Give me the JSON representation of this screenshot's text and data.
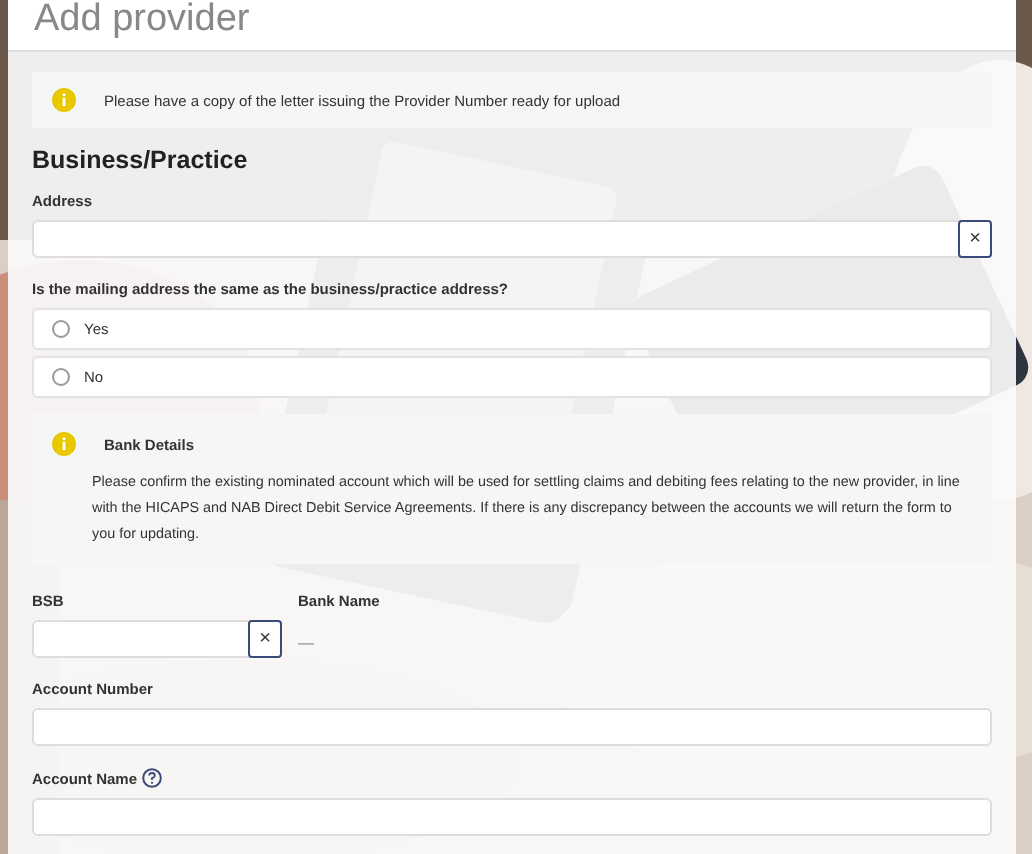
{
  "dialog": {
    "title": "Add provider"
  },
  "notice": {
    "text": "Please have a copy of the letter issuing the Provider Number ready for upload"
  },
  "section": {
    "heading": "Business/Practice"
  },
  "address": {
    "label": "Address",
    "clear_button": "×"
  },
  "mailing_question": {
    "label": "Is the mailing address the same as the business/practice address?",
    "options": [
      {
        "label": "Yes",
        "selected": false
      },
      {
        "label": "No",
        "selected": false
      }
    ]
  },
  "bank_notice": {
    "title": "Bank Details",
    "text": "Please confirm the existing nominated account which will be used for settling claims and debiting fees relating to the new provider, in line with the HICAPS and NAB Direct Debit Service Agreements. If there is any discrepancy between the accounts we will return the form to you for updating."
  },
  "bsb": {
    "label": "BSB",
    "clear_button": "×"
  },
  "bank_name": {
    "label": "Bank Name",
    "value": "—"
  },
  "account_number": {
    "label": "Account Number"
  },
  "account_name": {
    "label": "Account Name"
  }
}
